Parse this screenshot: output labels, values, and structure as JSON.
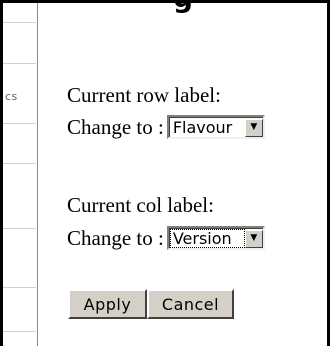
{
  "header": {
    "title_partial": "g"
  },
  "left_pane": {
    "tail_text": "cs"
  },
  "row_section": {
    "label": "Current row label:",
    "change_label": "Change to :",
    "select_value": "Flavour"
  },
  "col_section": {
    "label": "Current col label:",
    "change_label": "Change to :",
    "select_value": "Version"
  },
  "actions": {
    "apply_label": "Apply",
    "cancel_label": "Cancel"
  },
  "icons": {
    "dropdown": "chevron-down-icon"
  }
}
